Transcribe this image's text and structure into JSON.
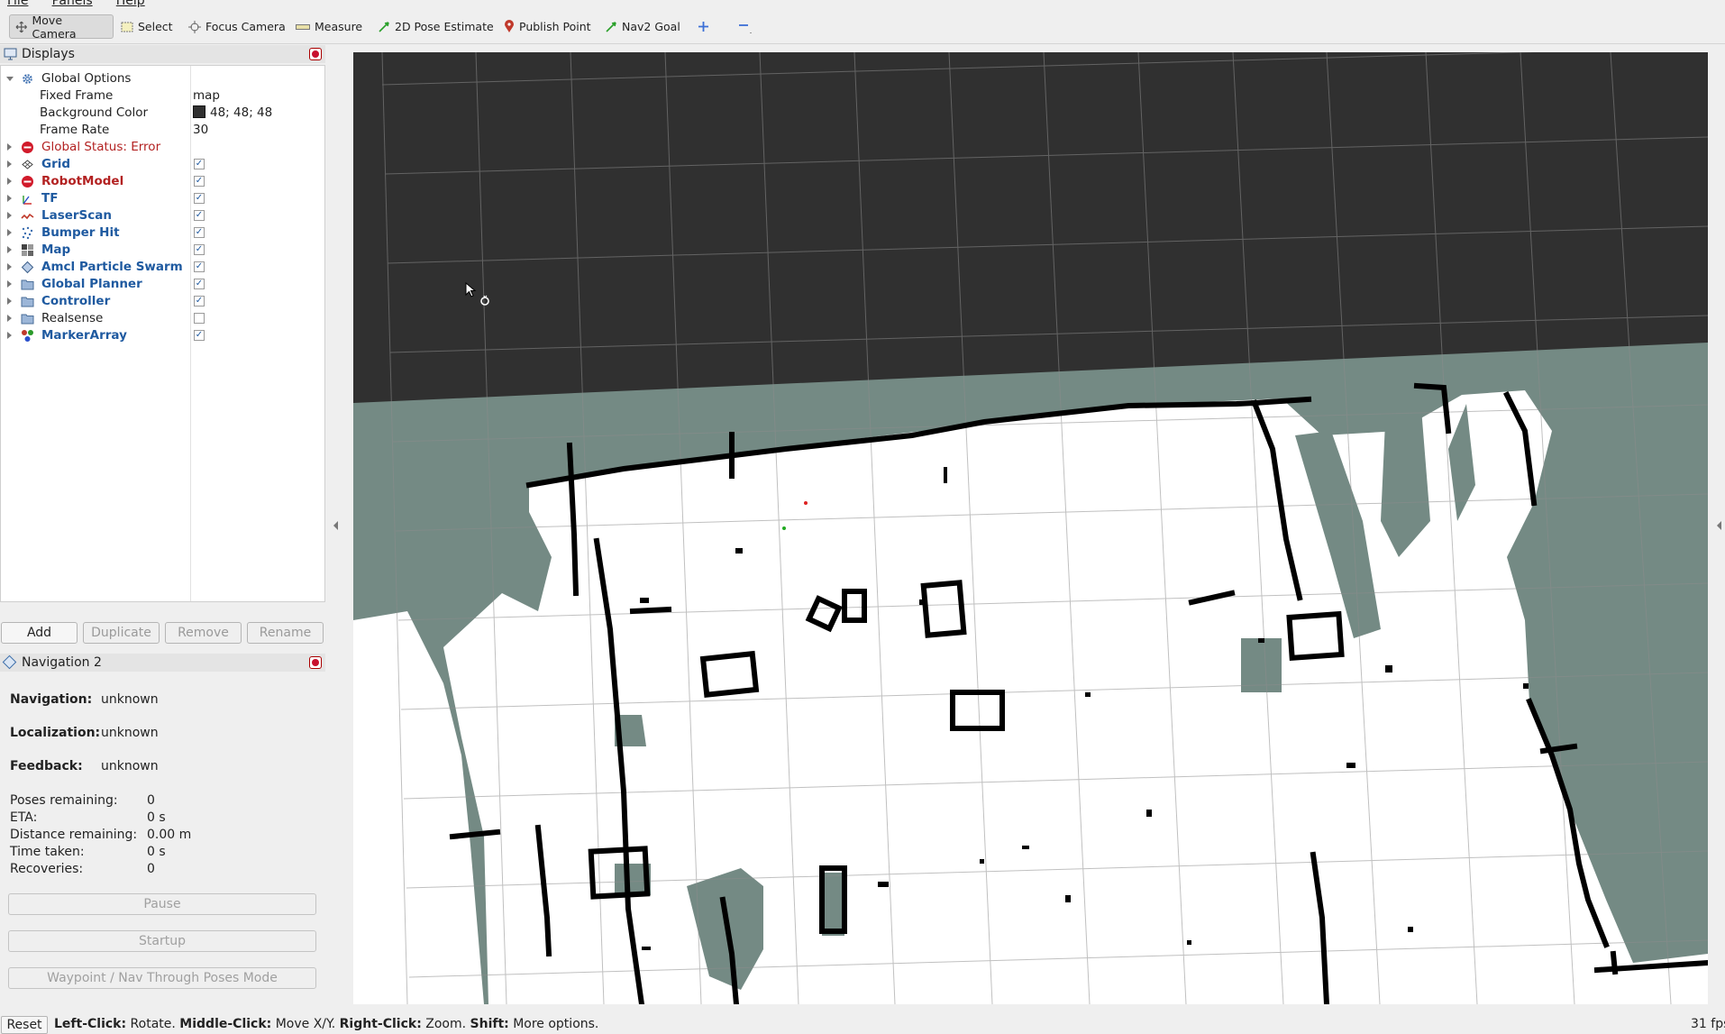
{
  "menu": [
    "File",
    "Panels",
    "Help"
  ],
  "toolbar": {
    "tools": [
      {
        "label": "Move Camera",
        "icon": "move-camera-icon",
        "active": true
      },
      {
        "label": "Select",
        "icon": "select-icon"
      },
      {
        "label": "Focus Camera",
        "icon": "focus-camera-icon"
      },
      {
        "label": "Measure",
        "icon": "measure-icon"
      },
      {
        "label": "2D Pose Estimate",
        "icon": "pose-estimate-icon"
      },
      {
        "label": "Publish Point",
        "icon": "publish-point-icon"
      },
      {
        "label": "Nav2 Goal",
        "icon": "nav2-goal-icon"
      }
    ]
  },
  "displays": {
    "title": "Displays",
    "global_options": {
      "label": "Global Options",
      "fixed_frame_label": "Fixed Frame",
      "fixed_frame_value": "map",
      "background_color_label": "Background Color",
      "background_color_value": "48; 48; 48",
      "frame_rate_label": "Frame Rate",
      "frame_rate_value": "30"
    },
    "global_status": "Global Status: Error",
    "items": [
      {
        "label": "Grid",
        "checked": true
      },
      {
        "label": "RobotModel",
        "checked": true,
        "error": true
      },
      {
        "label": "TF",
        "checked": true
      },
      {
        "label": "LaserScan",
        "checked": true
      },
      {
        "label": "Bumper Hit",
        "checked": true
      },
      {
        "label": "Map",
        "checked": true
      },
      {
        "label": "Amcl Particle Swarm",
        "checked": true
      },
      {
        "label": "Global Planner",
        "checked": true
      },
      {
        "label": "Controller",
        "checked": true
      },
      {
        "label": "Realsense",
        "checked": false
      },
      {
        "label": "MarkerArray",
        "checked": true
      }
    ],
    "buttons": {
      "add": "Add",
      "duplicate": "Duplicate",
      "remove": "Remove",
      "rename": "Rename"
    }
  },
  "nav2": {
    "title": "Navigation 2",
    "navigation_label": "Navigation:",
    "navigation_value": "unknown",
    "localization_label": "Localization:",
    "localization_value": "unknown",
    "feedback_label": "Feedback:",
    "feedback_value": "unknown",
    "stats": [
      {
        "label": "Poses remaining:",
        "value": "0"
      },
      {
        "label": "ETA:",
        "value": "0 s"
      },
      {
        "label": "Distance remaining:",
        "value": "0.00 m"
      },
      {
        "label": "Time taken:",
        "value": "0 s"
      },
      {
        "label": "Recoveries:",
        "value": "0"
      }
    ],
    "pause": "Pause",
    "startup": "Startup",
    "waypoint_mode": "Waypoint / Nav Through Poses Mode"
  },
  "statusbar": {
    "reset": "Reset",
    "left_click": "Left-Click:",
    "left_click_desc": "Rotate.",
    "middle_click": "Middle-Click:",
    "middle_click_desc": "Move X/Y.",
    "right_click": "Right-Click:",
    "right_click_desc": "Zoom.",
    "shift": "Shift:",
    "shift_desc": "More options.",
    "fps": "31 fps"
  },
  "colors": {
    "background": "#303030",
    "map_unknown": "#748a84",
    "map_free": "#ffffff",
    "map_occupied": "#000000",
    "error": "#b32222",
    "link": "#1f5aa0"
  }
}
